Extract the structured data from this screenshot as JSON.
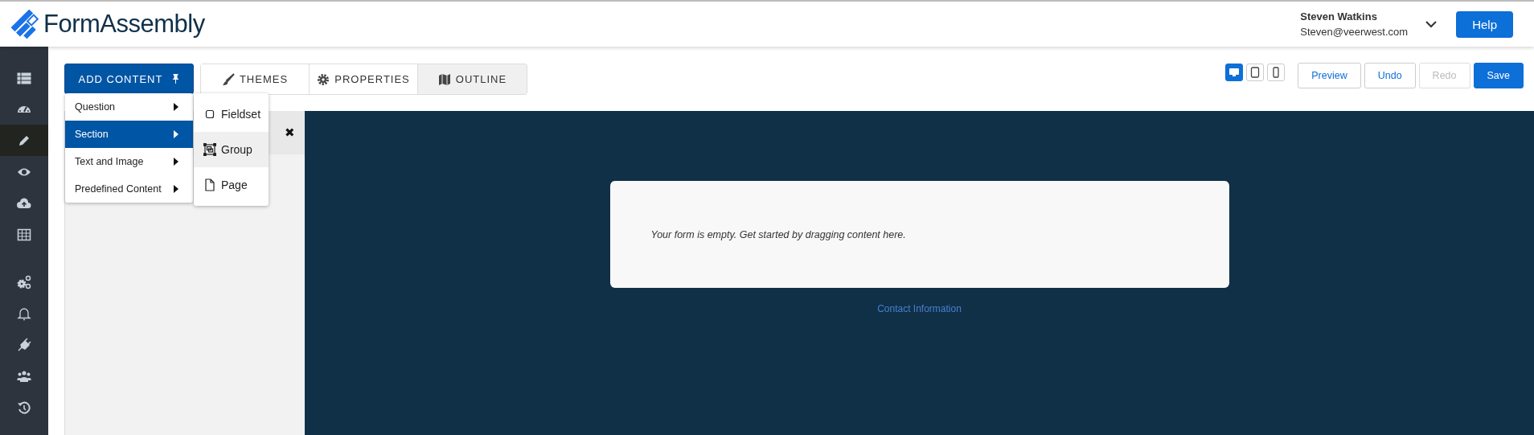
{
  "header": {
    "brand": "FormAssembly",
    "user": {
      "name": "Steven Watkins",
      "email": "Steven@veerwest.com"
    },
    "help": "Help"
  },
  "sidebar": {
    "groups": [
      {
        "items": [
          {
            "kind": "list",
            "selected": false
          },
          {
            "kind": "gauge",
            "selected": false
          },
          {
            "kind": "pencil",
            "selected": true
          },
          {
            "kind": "eye",
            "selected": false
          },
          {
            "kind": "upload",
            "selected": false
          },
          {
            "kind": "table",
            "selected": false
          }
        ]
      },
      {
        "items": [
          {
            "kind": "gears",
            "selected": false
          },
          {
            "kind": "bell",
            "selected": false
          },
          {
            "kind": "plug",
            "selected": false
          },
          {
            "kind": "users",
            "selected": false
          },
          {
            "kind": "history",
            "selected": false
          }
        ]
      }
    ]
  },
  "toolbar": {
    "add_content": "ADD CONTENT",
    "tabs": [
      {
        "kind": "brush",
        "label": "THEMES",
        "selected": false
      },
      {
        "kind": "gear",
        "label": "PROPERTIES",
        "selected": false
      },
      {
        "kind": "map",
        "label": "OUTLINE",
        "selected": true
      }
    ],
    "devices": [
      {
        "kind": "desktop",
        "selected": true
      },
      {
        "kind": "tablet",
        "selected": false
      },
      {
        "kind": "phone",
        "selected": false
      }
    ],
    "actions": [
      {
        "label": "Preview",
        "kind": "outline",
        "disabled": false
      },
      {
        "label": "Undo",
        "kind": "outline",
        "disabled": false
      },
      {
        "label": "Redo",
        "kind": "outline",
        "disabled": true
      },
      {
        "label": "Save",
        "kind": "primary",
        "disabled": false
      }
    ]
  },
  "menu": {
    "items": [
      {
        "label": "Question",
        "selected": false
      },
      {
        "label": "Section",
        "selected": true
      },
      {
        "label": "Text and Image",
        "selected": false
      },
      {
        "label": "Predefined Content",
        "selected": false
      }
    ],
    "submenu": [
      {
        "kind": "square",
        "label": "Fieldset",
        "selected": false
      },
      {
        "kind": "group",
        "label": "Group",
        "selected": true
      },
      {
        "kind": "page",
        "label": "Page",
        "selected": false
      }
    ]
  },
  "panel": {
    "close": "✖"
  },
  "canvas": {
    "message": "Your form is empty. Get started by dragging content here.",
    "footer_link": "Contact Information"
  }
}
